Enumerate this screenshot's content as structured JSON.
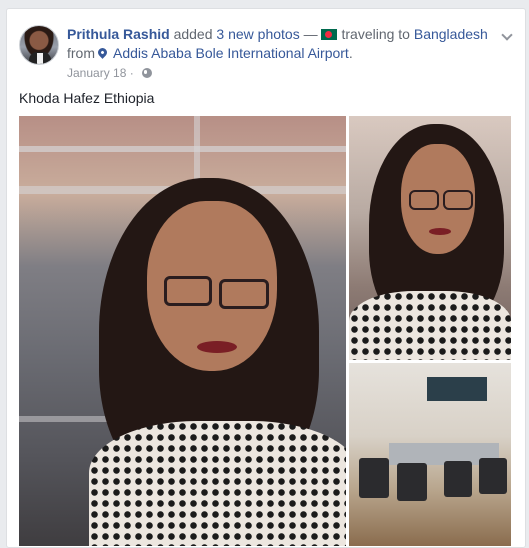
{
  "post": {
    "author": "Prithula Rashid",
    "action_text": "added",
    "photo_count_text": "3 new photos",
    "dash": "—",
    "activity": "traveling to",
    "destination": "Bangladesh",
    "from_text": "from",
    "origin": "Addis Ababa Bole International Airport",
    "origin_period": ".",
    "date": "January 18",
    "separator": "·",
    "status_text": "Khoda Hafez Ethiopia"
  },
  "icons": {
    "flag": "bangladesh-flag-icon",
    "location": "location-pin-icon",
    "privacy": "globe-icon",
    "menu": "chevron-down-icon"
  },
  "colors": {
    "link": "#365899",
    "meta": "#90949c",
    "text": "#1d2129",
    "background": "#e9ebee"
  }
}
